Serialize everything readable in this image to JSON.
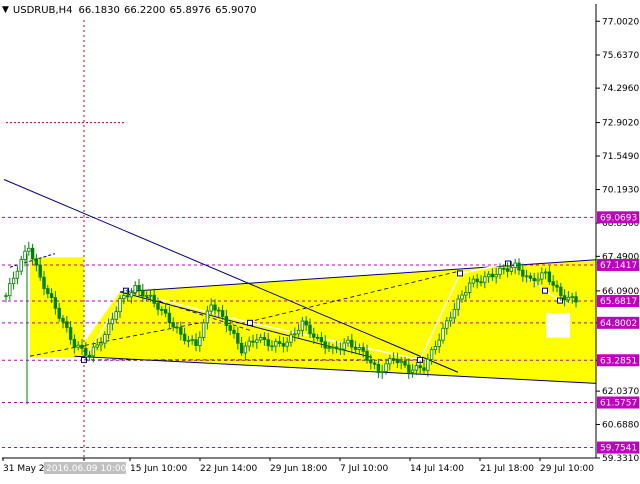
{
  "window": {
    "symbol_label": "USDRUB,H4",
    "ohlc_text": "66.1830 66.2200 65.8976 65.9070",
    "collapse_icon": "triangle-down-icon"
  },
  "colors": {
    "background": "#ffffff",
    "axis": "#000000",
    "candle": "#008000",
    "highlight_zone": "#ffff00",
    "channel_line": "#000080",
    "level_line": "#c000c0",
    "level_label_bg": "#c000c0",
    "level_label_text": "#ffffff",
    "white_trend": "#ffffff",
    "dash_line": "#000000"
  },
  "chart_data": {
    "type": "candlestick",
    "title": "",
    "xlabel": "",
    "ylabel": "",
    "ylim": [
      59.331,
      77.7
    ],
    "y_ticks": [
      "77.0020",
      "75.6370",
      "74.2960",
      "72.9020",
      "71.5490",
      "70.1930",
      "68.8360",
      "67.4900",
      "66.0900",
      "64.8020",
      "63.2851",
      "62.0370",
      "60.6880",
      "59.3310"
    ],
    "x_ticks": [
      "31 May 2016",
      "2016.06.09 10:00",
      "15 Jun 10:00",
      "22 Jun 14:00",
      "29 Jun 18:00",
      "7 Jul 10:00",
      "14 Jul 14:00",
      "21 Jul 18:00",
      "29 Jul 10:00"
    ],
    "highlighted_x_label": "2016.06.09 10:00",
    "levels": [
      {
        "label": "69.0693",
        "value": 69.0693
      },
      {
        "label": "67.1417",
        "value": 67.1417
      },
      {
        "label": "65.6817",
        "value": 65.6817
      },
      {
        "label": "64.8002",
        "value": 64.8002
      },
      {
        "label": "63.2851",
        "value": 63.2851
      },
      {
        "label": "61.5757",
        "value": 61.5757
      },
      {
        "label": "59.7541",
        "value": 59.7541
      }
    ],
    "forecast_levels": [
      72.902,
      66.09
    ],
    "anchors": [
      {
        "i": 0,
        "v": 65.9
      },
      {
        "i": 3,
        "v": 67.0
      },
      {
        "i": 6,
        "v": 67.9
      },
      {
        "i": 9,
        "v": 66.6
      },
      {
        "i": 14,
        "v": 65.1
      },
      {
        "i": 18,
        "v": 63.9
      },
      {
        "i": 22,
        "v": 63.5
      },
      {
        "i": 26,
        "v": 64.3
      },
      {
        "i": 30,
        "v": 65.7
      },
      {
        "i": 34,
        "v": 66.2
      },
      {
        "i": 38,
        "v": 65.8
      },
      {
        "i": 42,
        "v": 65.1
      },
      {
        "i": 46,
        "v": 64.3
      },
      {
        "i": 50,
        "v": 63.9
      },
      {
        "i": 54,
        "v": 65.6
      },
      {
        "i": 58,
        "v": 64.8
      },
      {
        "i": 62,
        "v": 63.7
      },
      {
        "i": 66,
        "v": 64.2
      },
      {
        "i": 70,
        "v": 63.9
      },
      {
        "i": 74,
        "v": 64.0
      },
      {
        "i": 78,
        "v": 64.8
      },
      {
        "i": 82,
        "v": 64.1
      },
      {
        "i": 86,
        "v": 63.7
      },
      {
        "i": 90,
        "v": 64.0
      },
      {
        "i": 94,
        "v": 63.6
      },
      {
        "i": 98,
        "v": 62.8
      },
      {
        "i": 102,
        "v": 63.4
      },
      {
        "i": 106,
        "v": 62.9
      },
      {
        "i": 110,
        "v": 63.0
      },
      {
        "i": 114,
        "v": 64.2
      },
      {
        "i": 118,
        "v": 65.4
      },
      {
        "i": 122,
        "v": 66.4
      },
      {
        "i": 126,
        "v": 66.6
      },
      {
        "i": 130,
        "v": 66.9
      },
      {
        "i": 134,
        "v": 67.1
      },
      {
        "i": 138,
        "v": 66.5
      },
      {
        "i": 142,
        "v": 66.8
      },
      {
        "i": 146,
        "v": 65.9
      },
      {
        "i": 150,
        "v": 65.7
      }
    ]
  }
}
